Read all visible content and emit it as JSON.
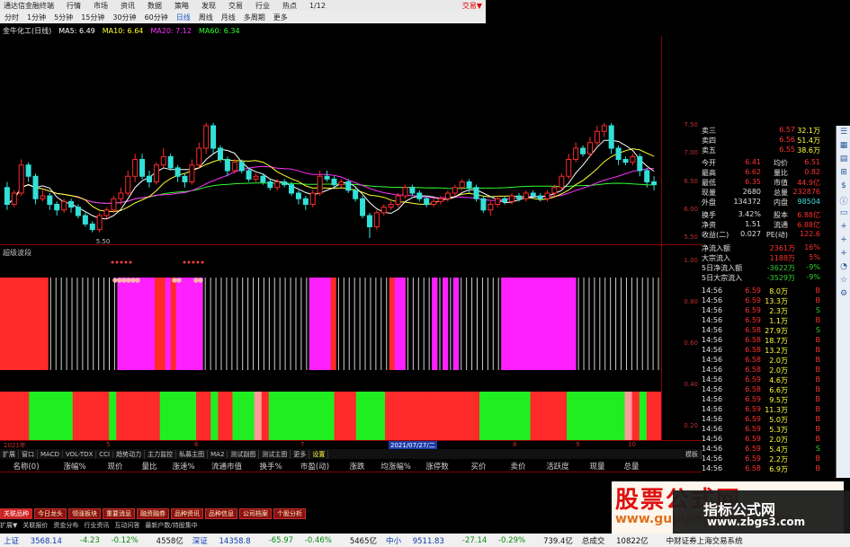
{
  "titlebar": {
    "app": "通达信金融终端",
    "menu": [
      "行情",
      "市场",
      "资讯",
      "数据",
      "策略",
      "发现",
      "交易",
      "行业",
      "热点",
      "1/12"
    ],
    "right": "交易▼"
  },
  "toolbar": [
    "分时",
    "1分钟",
    "5分钟",
    "15分钟",
    "30分钟",
    "60分钟",
    "日线",
    "周线",
    "月线",
    "多周期",
    "更多"
  ],
  "mabar": {
    "stock": "金牛化工(日线)",
    "ma5": "MA5: 6.49",
    "ma10": "MA10: 6.64",
    "ma20": "MA20: 7.12",
    "ma60": "MA60: 6.34"
  },
  "colors": {
    "up": "#ff2a2a",
    "down": "#32e0d8",
    "ma5": "#ffffff",
    "ma10": "#ffff30",
    "ma20": "#ff30ff",
    "ma60": "#30ff30",
    "magenta": "#ff20ff",
    "green": "#20ee20"
  },
  "chart_data": {
    "type": "candlestick",
    "ylim": [
      5.5,
      7.5
    ],
    "yticks": [
      "7.50",
      "7.00",
      "6.50",
      "6.00",
      "5.50"
    ],
    "min_label": "5.50",
    "candles": [
      [
        6.4,
        6.1,
        6.5,
        6.0
      ],
      [
        6.1,
        6.3,
        6.35,
        6.05
      ],
      [
        6.3,
        6.8,
        6.9,
        6.25
      ],
      [
        6.8,
        6.6,
        6.85,
        6.5
      ],
      [
        6.6,
        6.2,
        6.65,
        6.1
      ],
      [
        6.2,
        6.25,
        6.35,
        6.15
      ],
      [
        6.25,
        6.1,
        6.3,
        6.0
      ],
      [
        6.1,
        6.0,
        6.15,
        5.9
      ],
      [
        6.0,
        6.15,
        6.2,
        5.95
      ],
      [
        6.15,
        6.05,
        6.2,
        5.95
      ],
      [
        6.05,
        5.9,
        6.1,
        5.85
      ],
      [
        5.9,
        5.75,
        5.95,
        5.7
      ],
      [
        5.75,
        5.65,
        5.8,
        5.6
      ],
      [
        5.65,
        5.9,
        5.95,
        5.6
      ],
      [
        5.9,
        6.0,
        6.05,
        5.85
      ],
      [
        6.0,
        6.2,
        6.25,
        5.95
      ],
      [
        6.2,
        6.3,
        6.4,
        6.1
      ],
      [
        6.3,
        6.6,
        6.7,
        6.25
      ],
      [
        6.6,
        6.9,
        7.0,
        6.5
      ],
      [
        6.9,
        6.6,
        7.0,
        6.55
      ],
      [
        6.6,
        6.5,
        6.7,
        6.4
      ],
      [
        6.5,
        6.8,
        6.85,
        6.45
      ],
      [
        6.8,
        6.95,
        7.1,
        6.75
      ],
      [
        6.95,
        6.75,
        7.0,
        6.7
      ],
      [
        6.75,
        6.6,
        6.8,
        6.5
      ],
      [
        6.6,
        6.5,
        6.65,
        6.4
      ],
      [
        6.5,
        6.8,
        6.9,
        6.45
      ],
      [
        6.8,
        7.1,
        7.2,
        6.75
      ],
      [
        7.1,
        7.5,
        7.55,
        7.0
      ],
      [
        7.5,
        7.1,
        7.55,
        7.0
      ],
      [
        7.1,
        6.9,
        7.15,
        6.85
      ],
      [
        6.9,
        6.7,
        6.95,
        6.6
      ],
      [
        6.7,
        6.85,
        6.9,
        6.65
      ],
      [
        6.85,
        6.7,
        6.9,
        6.65
      ],
      [
        6.7,
        6.55,
        6.75,
        6.5
      ],
      [
        6.55,
        6.6,
        6.65,
        6.5
      ],
      [
        6.6,
        6.5,
        6.65,
        6.45
      ],
      [
        6.5,
        6.4,
        6.55,
        6.35
      ],
      [
        6.4,
        6.5,
        6.55,
        6.35
      ],
      [
        6.5,
        6.45,
        6.55,
        6.4
      ],
      [
        6.45,
        6.3,
        6.5,
        6.25
      ],
      [
        6.3,
        6.2,
        6.35,
        6.1
      ],
      [
        6.2,
        6.1,
        6.25,
        6.0
      ],
      [
        6.1,
        6.3,
        6.35,
        6.05
      ],
      [
        6.3,
        6.6,
        6.7,
        6.25
      ],
      [
        6.6,
        6.55,
        6.7,
        6.5
      ],
      [
        6.55,
        6.45,
        6.6,
        6.4
      ],
      [
        6.45,
        6.5,
        6.55,
        6.4
      ],
      [
        6.5,
        6.35,
        6.55,
        6.3
      ],
      [
        6.35,
        6.2,
        6.4,
        6.15
      ],
      [
        6.2,
        5.9,
        6.25,
        5.85
      ],
      [
        5.9,
        5.7,
        5.95,
        5.5
      ],
      [
        5.7,
        5.95,
        6.0,
        5.65
      ],
      [
        5.95,
        6.05,
        6.1,
        5.9
      ],
      [
        6.05,
        6.1,
        6.15,
        6.0
      ],
      [
        6.1,
        6.25,
        6.3,
        6.05
      ],
      [
        6.25,
        6.4,
        6.45,
        6.2
      ],
      [
        6.4,
        6.3,
        6.45,
        6.25
      ],
      [
        6.3,
        6.2,
        6.35,
        6.15
      ],
      [
        6.2,
        6.1,
        6.25,
        6.05
      ],
      [
        6.1,
        6.15,
        6.2,
        6.05
      ],
      [
        6.15,
        6.2,
        6.25,
        6.1
      ],
      [
        6.2,
        6.3,
        6.35,
        6.15
      ],
      [
        6.3,
        6.4,
        6.45,
        6.25
      ],
      [
        6.4,
        6.5,
        6.55,
        6.35
      ],
      [
        6.5,
        6.4,
        6.55,
        6.3
      ],
      [
        6.4,
        6.2,
        6.45,
        6.15
      ],
      [
        6.2,
        6.0,
        6.25,
        5.95
      ],
      [
        6.0,
        6.1,
        6.15,
        5.9
      ],
      [
        6.1,
        6.2,
        6.25,
        6.05
      ],
      [
        6.2,
        6.15,
        6.25,
        6.1
      ],
      [
        6.15,
        6.25,
        6.3,
        6.1
      ],
      [
        6.25,
        6.2,
        6.3,
        6.15
      ],
      [
        6.2,
        6.3,
        6.35,
        6.15
      ],
      [
        6.3,
        6.25,
        6.35,
        6.2
      ],
      [
        6.25,
        6.2,
        6.3,
        6.15
      ],
      [
        6.2,
        6.3,
        6.35,
        6.15
      ],
      [
        6.3,
        6.4,
        6.45,
        6.25
      ],
      [
        6.4,
        6.6,
        6.65,
        6.35
      ],
      [
        6.6,
        6.9,
        7.0,
        6.55
      ],
      [
        6.9,
        7.1,
        7.2,
        6.85
      ],
      [
        7.1,
        7.0,
        7.15,
        6.95
      ],
      [
        7.0,
        7.2,
        7.3,
        6.95
      ],
      [
        7.2,
        7.4,
        7.5,
        7.15
      ],
      [
        7.4,
        7.5,
        7.55,
        7.3
      ],
      [
        7.5,
        7.1,
        7.55,
        7.0
      ],
      [
        7.1,
        6.9,
        7.15,
        6.8
      ],
      [
        6.9,
        6.85,
        6.95,
        6.8
      ],
      [
        6.85,
        6.95,
        7.0,
        6.8
      ],
      [
        6.95,
        6.7,
        7.0,
        6.6
      ],
      [
        6.7,
        6.5,
        6.75,
        6.4
      ],
      [
        6.5,
        6.45,
        6.6,
        6.35
      ]
    ],
    "signals": [
      "r",
      "r",
      "r",
      "r",
      "r",
      "r",
      "r",
      "r",
      "r",
      "w",
      "w",
      "w",
      "w",
      "w",
      "w",
      "w",
      "w",
      "w",
      "w",
      "w",
      "w",
      "w",
      "m",
      "m",
      "m",
      "m",
      "m",
      "m",
      "m",
      "r",
      "r",
      "m",
      "r",
      "m",
      "m",
      "m",
      "m",
      "m",
      "w",
      "w",
      "w",
      "w",
      "w",
      "w",
      "w",
      "w",
      "w",
      "w",
      "w",
      "w",
      "w",
      "w",
      "w",
      "w",
      "w",
      "w",
      "w",
      "w",
      "m",
      "m",
      "m",
      "m",
      "r",
      "w",
      "w",
      "w",
      "w",
      "w",
      "w",
      "w",
      "w",
      "w",
      "w",
      "r",
      "m",
      "m",
      "w",
      "w",
      "w",
      "w",
      "w",
      "m",
      "w",
      "m",
      "w",
      "m",
      "w",
      "w",
      "w",
      "w",
      "w",
      "w",
      "w",
      "w",
      "m",
      "m",
      "m",
      "m",
      "m",
      "m",
      "m",
      "m",
      "m",
      "m",
      "m",
      "m",
      "m",
      "m",
      "w",
      "w",
      "w",
      "w",
      "w",
      "w",
      "w",
      "w",
      "w",
      "w",
      "w",
      "w",
      "w",
      "w",
      "w",
      "w"
    ],
    "bands": [
      "r",
      "r",
      "r",
      "r",
      "g",
      "g",
      "g",
      "g",
      "g",
      "g",
      "r",
      "r",
      "r",
      "r",
      "r",
      "g",
      "r",
      "r",
      "r",
      "r",
      "r",
      "r",
      "g",
      "g",
      "g",
      "g",
      "g",
      "r",
      "r",
      "g",
      "r",
      "r",
      "g",
      "g",
      "g",
      "p",
      "r",
      "g",
      "g",
      "g",
      "g",
      "g",
      "g",
      "g",
      "g",
      "g",
      "r",
      "r",
      "r",
      "g",
      "g",
      "g",
      "g",
      "r",
      "r",
      "r",
      "r",
      "r",
      "r",
      "r",
      "r",
      "r",
      "r",
      "r",
      "r",
      "r",
      "g",
      "g",
      "g",
      "g",
      "g",
      "g",
      "g",
      "r",
      "r",
      "r",
      "r",
      "r",
      "g",
      "g",
      "g",
      "g",
      "g",
      "g",
      "g",
      "g",
      "p",
      "r",
      "g",
      "r",
      "r"
    ]
  },
  "sub_title": "超级波段",
  "sub_axis": [
    "1.00",
    "0.80",
    "0.60",
    "0.40",
    "0.20"
  ],
  "date_labels": [
    "2021年",
    "5",
    "6",
    "7",
    "2021/07/27/二",
    "8",
    "9",
    "10"
  ],
  "indicator_tabs": [
    "扩展",
    "窗口",
    "MACD",
    "VOL-TDX",
    "CCI",
    "趋势动力",
    "主力监控",
    "私募主图",
    "MA2",
    "测试副图",
    "测试主图",
    "更多",
    "设置"
  ],
  "indicator_right": "模板",
  "columns": [
    "名称(0)",
    "涨幅%",
    "现价",
    "量比",
    "涨速%",
    "流通市值",
    "换手%",
    "市盈(动)",
    "涨跌",
    "均涨幅%",
    "涨停数",
    "买价",
    "卖价",
    "活跃度",
    "现量",
    "总量"
  ],
  "bottom_tabs": [
    "关联品种",
    "今日龙头",
    "领涨板块",
    "重要消息",
    "融资融券",
    "品种资讯",
    "品种信息",
    "公司档案",
    "个股分析"
  ],
  "bottom_tabs2": [
    "扩展▼",
    "关联报价",
    "资金分布",
    "行业资讯",
    "互动问答",
    "最新户数/持股集中"
  ],
  "status": [
    "上证",
    "3568.14",
    "-4.23",
    "-0.12%",
    "4558亿",
    "深证",
    "14358.8",
    "-65.97",
    "-0.46%",
    "5465亿",
    "中小",
    "9511.83",
    "-27.14",
    "-0.29%",
    "739.4亿",
    "总成交",
    "10822亿",
    "中财证券上海交易系统"
  ],
  "panel": [
    [
      "卖三",
      "6.57",
      "32.1万"
    ],
    [
      "卖四",
      "6.56",
      "51.4万"
    ],
    [
      "卖五",
      "6.55",
      "38.6万"
    ],
    [
      "今开",
      "6.41",
      "均价",
      "6.51"
    ],
    [
      "最高",
      "6.62",
      "量比",
      "0.82"
    ],
    [
      "最低",
      "6.35",
      "市值",
      "44.9亿"
    ],
    [
      "现量",
      "2680",
      "总量",
      "232876"
    ],
    [
      "外盘",
      "134372",
      "内盘",
      "98504"
    ],
    [
      "换手",
      "3.42%",
      "股本",
      "6.88亿"
    ],
    [
      "净资",
      "1.51",
      "流通",
      "6.88亿"
    ],
    [
      "收益(二)",
      "0.027",
      "PE(动)",
      "122.6"
    ]
  ],
  "flow": [
    [
      "净流入额",
      "2361万",
      "16%"
    ],
    [
      "大宗流入",
      "1188万",
      "5%"
    ],
    [
      "5日净流入额",
      "-3622万",
      "-9%"
    ],
    [
      "5日大宗流入",
      "-3529万",
      "-9%"
    ]
  ],
  "ticks": [
    [
      "14:56",
      "6.59",
      "8.0万",
      "B"
    ],
    [
      "14:56",
      "6.59",
      "13.3万",
      "B"
    ],
    [
      "14:56",
      "6.59",
      "2.3万",
      "S"
    ],
    [
      "14:56",
      "6.59",
      "1.1万",
      "B"
    ],
    [
      "14:56",
      "6.58",
      "27.9万",
      "S"
    ],
    [
      "14:56",
      "6.58",
      "18.7万",
      "B"
    ],
    [
      "14:56",
      "6.58",
      "13.2万",
      "B"
    ],
    [
      "14:56",
      "6.58",
      "2.0万",
      "B"
    ],
    [
      "14:56",
      "6.58",
      "2.0万",
      "B"
    ],
    [
      "14:56",
      "6.59",
      "4.6万",
      "B"
    ],
    [
      "14:56",
      "6.58",
      "6.6万",
      "B"
    ],
    [
      "14:56",
      "6.59",
      "9.5万",
      "B"
    ],
    [
      "14:56",
      "6.59",
      "11.3万",
      "B"
    ],
    [
      "14:56",
      "6.59",
      "5.0万",
      "B"
    ],
    [
      "14:56",
      "6.59",
      "5.3万",
      "B"
    ],
    [
      "14:56",
      "6.59",
      "2.0万",
      "B"
    ],
    [
      "14:56",
      "6.59",
      "5.4万",
      "S"
    ],
    [
      "14:56",
      "6.59",
      "2.2万",
      "B"
    ],
    [
      "14:56",
      "6.58",
      "6.9万",
      "B"
    ]
  ],
  "watermark": {
    "big": "股票公式网",
    "small": "www.gupiaogongshi.com",
    "cn": "指标公式网",
    "url": "www.zbgs3.com"
  },
  "sidebar_icons": [
    "list-icon",
    "table-icon",
    "chart-icon",
    "grid-icon",
    "fund-icon",
    "info-icon",
    "book-icon",
    "plus-icon",
    "plus-icon",
    "plus-icon",
    "bell-icon",
    "star-icon",
    "gear-icon"
  ]
}
